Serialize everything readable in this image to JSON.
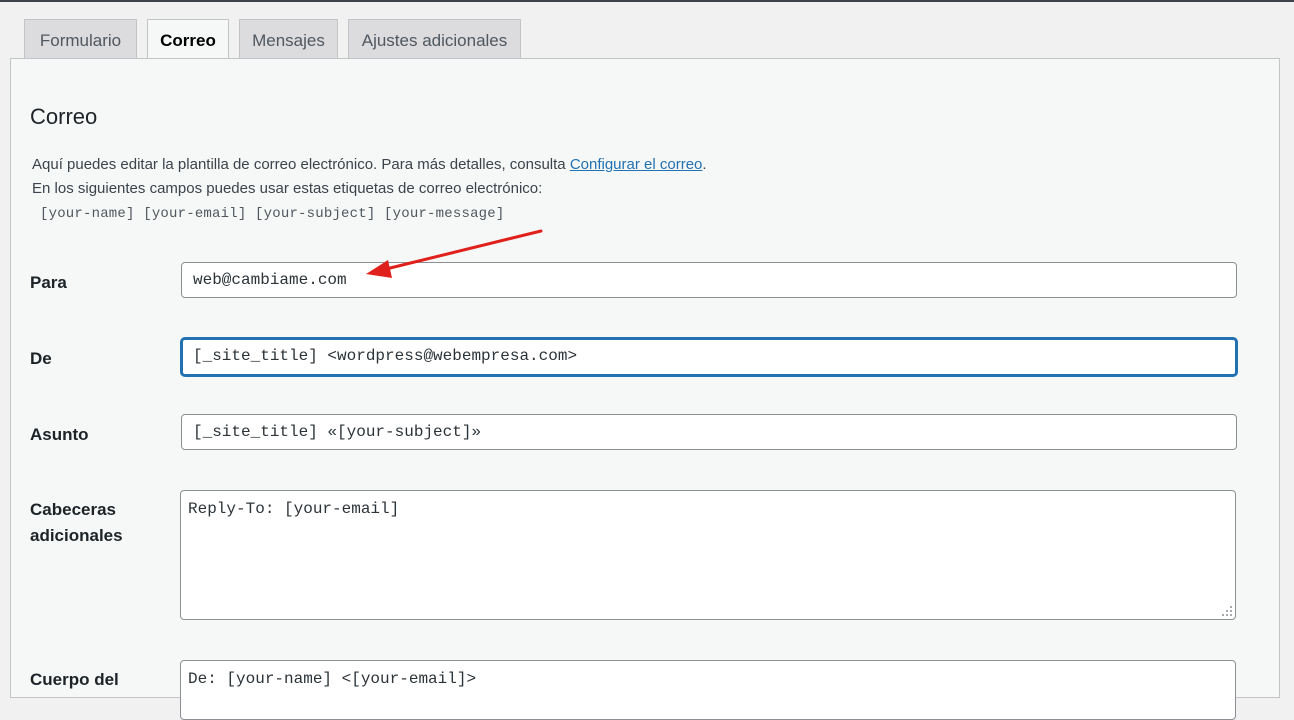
{
  "tabs": [
    {
      "label": "Formulario",
      "active": false
    },
    {
      "label": "Correo",
      "active": true
    },
    {
      "label": "Mensajes",
      "active": false
    },
    {
      "label": "Ajustes adicionales",
      "active": false
    }
  ],
  "section": {
    "title": "Correo",
    "desc_line1_before": "Aquí puedes editar la plantilla de correo electrónico. Para más detalles, consulta ",
    "desc_link": "Configurar el correo",
    "desc_line1_after": ".",
    "desc_line2": "En los siguientes campos puedes usar estas etiquetas de correo electrónico:",
    "tags": "[your-name] [your-email] [your-subject] [your-message]"
  },
  "fields": {
    "para": {
      "label": "Para",
      "value": "web@cambiame.com"
    },
    "de": {
      "label": "De",
      "value": "[_site_title] <wordpress@webempresa.com>"
    },
    "asunto": {
      "label": "Asunto",
      "value": "[_site_title] «[your-subject]»"
    },
    "cabeceras": {
      "label_line1": "Cabeceras",
      "label_line2": "adicionales",
      "value": "Reply-To: [your-email]"
    },
    "cuerpo": {
      "label_line1": "Cuerpo del",
      "value": "De: [your-name] <[your-email]>"
    }
  },
  "colors": {
    "accent": "#2271b1",
    "annotation_arrow": "#e0201b"
  },
  "icons": {
    "annotation": "red-arrow-icon",
    "resize": "resize-grip-icon"
  }
}
